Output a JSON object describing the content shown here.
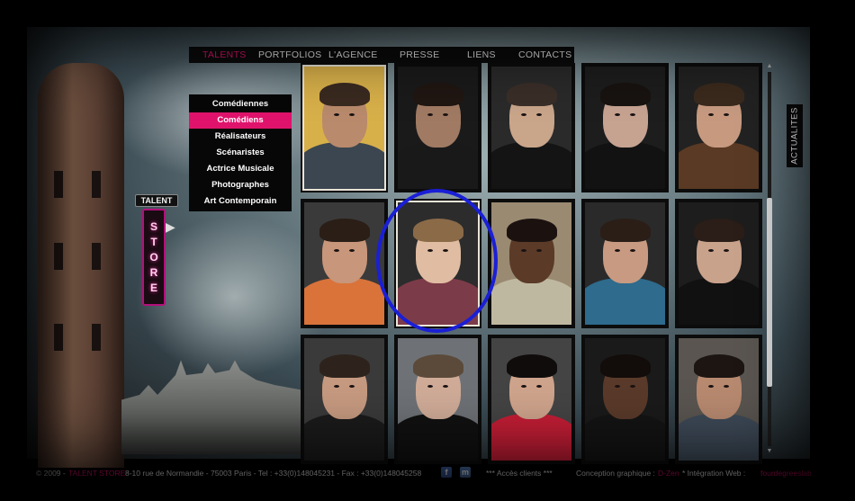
{
  "nav": {
    "items": [
      {
        "label": "TALENTS",
        "active": true
      },
      {
        "label": "PORTFOLIOS",
        "active": false
      },
      {
        "label": "L'AGENCE",
        "active": false
      },
      {
        "label": "PRESSE",
        "active": false
      },
      {
        "label": "LIENS",
        "active": false
      },
      {
        "label": "CONTACTS",
        "active": false
      }
    ]
  },
  "submenu": {
    "items": [
      {
        "label": "Comédiennes",
        "active": false
      },
      {
        "label": "Comédiens",
        "active": true
      },
      {
        "label": "Réalisateurs",
        "active": false
      },
      {
        "label": "Scénaristes",
        "active": false
      },
      {
        "label": "Actrice Musicale",
        "active": false
      },
      {
        "label": "Photographes",
        "active": false
      },
      {
        "label": "Art Contemporain",
        "active": false
      }
    ]
  },
  "sign": {
    "top": "TALENT",
    "letters": [
      "S",
      "T",
      "O",
      "R",
      "E"
    ]
  },
  "side_tab": {
    "label": "ACTUALITES"
  },
  "grid": {
    "rows": 3,
    "cols": 5,
    "highlighted_index": 6,
    "portraits": [
      {
        "bg": "#d8b04a",
        "skin": "#b98a6c",
        "hair": "#3a2a20",
        "top": "#3c4650",
        "framed": true
      },
      {
        "bg": "#1a1a1a",
        "skin": "#a07a63",
        "hair": "#201612",
        "top": "#191919",
        "framed": false
      },
      {
        "bg": "#2a2a2a",
        "skin": "#c9a58a",
        "hair": "#3a2e28",
        "top": "#141414",
        "framed": false
      },
      {
        "bg": "#1d1d1d",
        "skin": "#c6a291",
        "hair": "#181310",
        "top": "#121212",
        "framed": false
      },
      {
        "bg": "#222",
        "skin": "#c79a80",
        "hair": "#3b2a1d",
        "top": "#5a3a24",
        "framed": false
      },
      {
        "bg": "#3a3a3a",
        "skin": "#c8967a",
        "hair": "#2a1e17",
        "top": "#d9733a",
        "framed": false
      },
      {
        "bg": "#2c2c2c",
        "skin": "#dfbca2",
        "hair": "#8b6a48",
        "top": "#7c3b48",
        "framed": true
      },
      {
        "bg": "#9a8a72",
        "skin": "#5b3a28",
        "hair": "#1b1210",
        "top": "#bfb8a0",
        "framed": false
      },
      {
        "bg": "#2a2a2a",
        "skin": "#c89a82",
        "hair": "#2a1e17",
        "top": "#2e6b8c",
        "framed": false
      },
      {
        "bg": "#1d1d1d",
        "skin": "#c9a28c",
        "hair": "#2b1d17",
        "top": "#111",
        "framed": false
      },
      {
        "bg": "#3a3a3a",
        "skin": "#c69a80",
        "hair": "#2d231c",
        "top": "#1b1b1b",
        "framed": false
      },
      {
        "bg": "#6e7276",
        "skin": "#d0ac98",
        "hair": "#5b4a3a",
        "top": "#111",
        "framed": false
      },
      {
        "bg": "#444",
        "skin": "#cfa48c",
        "hair": "#0f0c0b",
        "top": "#c61e36",
        "framed": false
      },
      {
        "bg": "#1a1a1a",
        "skin": "#5a3a2a",
        "hair": "#120c0a",
        "top": "#141414",
        "framed": false
      },
      {
        "bg": "#5a5550",
        "skin": "#b88a70",
        "hair": "#1c1512",
        "top": "#3e4a58",
        "framed": false
      }
    ]
  },
  "footer": {
    "copyright": "© 2009 -",
    "brand": "TALENT STORE",
    "address": "8-10 rue de Normandie - 75003 Paris - Tel : +33(0)148045231 - Fax : +33(0)148045258",
    "clients": "*** Accès clients ***",
    "conception_label": "Conception graphique :",
    "conception_name": "D-Zen",
    "integration_label": "* Intégration Web :",
    "integration_name": "fourdegreeslab"
  },
  "colors": {
    "accent": "#e0136c",
    "highlight_circle": "#1a1fd6"
  }
}
